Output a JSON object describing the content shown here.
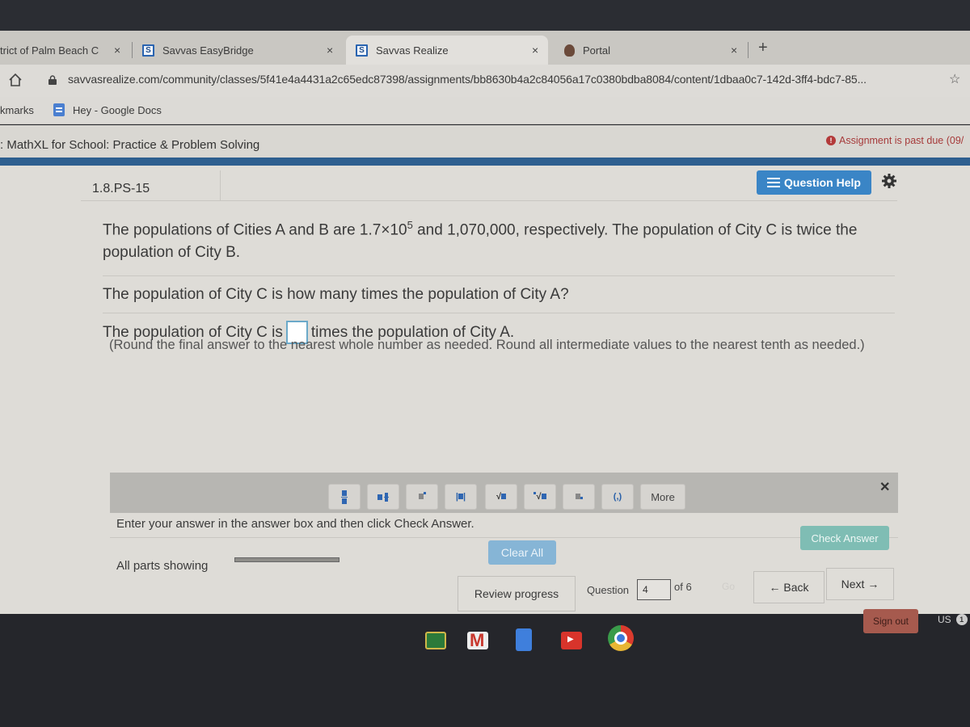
{
  "browser": {
    "tabs": [
      {
        "title": "trict of Palm Beach C",
        "favicon": "district-icon",
        "active": false
      },
      {
        "title": "Savvas EasyBridge",
        "favicon": "savvas-icon",
        "active": false
      },
      {
        "title": "Savvas Realize",
        "favicon": "savvas-icon",
        "active": true
      },
      {
        "title": "Portal",
        "favicon": "portal-icon",
        "active": false
      }
    ],
    "favicon_letter": "S",
    "close_glyph": "×",
    "new_tab_glyph": "+",
    "url": "savvasrealize.com/community/classes/5f41e4a4431a2c65edc87398/assignments/bb8630b4a2c84056a17c0380bdba8084/content/1dbaa0c7-142d-3ff4-bdc7-85...",
    "star_glyph": "☆",
    "bookmarks_label": "kmarks",
    "bookmarks": [
      {
        "label": "Hey - Google Docs",
        "icon": "google-docs-icon"
      }
    ]
  },
  "app": {
    "title": ": MathXL for School: Practice & Problem Solving",
    "due_notice": "Assignment is past due (09/",
    "due_icon": "!",
    "question_id": "1.8.PS-15",
    "question_help_label": "Question Help"
  },
  "question": {
    "intro_part1": "The populations of Cities A and B are 1.7",
    "times": "×",
    "base": "10",
    "exponent": "5",
    "intro_part2": " and 1,070,000, respectively. The population of City C is twice the population of City B.",
    "prompt": "The population of City C is how many times the population of City A?",
    "answer_prefix": "The population of City C is",
    "answer_value": "",
    "answer_suffix": "times the population of City A.",
    "rounding_note": "(Round the final answer to the nearest whole number as needed. Round all intermediate values to the nearest tenth as needed.)"
  },
  "palette": {
    "buttons": [
      {
        "name": "fraction",
        "label": ""
      },
      {
        "name": "mixed-number",
        "label": ""
      },
      {
        "name": "exponent",
        "label": ""
      },
      {
        "name": "absolute-value",
        "label": ""
      },
      {
        "name": "square-root",
        "label": "√"
      },
      {
        "name": "nth-root",
        "label": "√"
      },
      {
        "name": "subscript",
        "label": ""
      },
      {
        "name": "ordered-pair",
        "label": "(,)"
      }
    ],
    "more_label": "More",
    "close_glyph": "✕"
  },
  "footer": {
    "instructions": "Enter your answer in the answer box and then click Check Answer.",
    "parts_label": "All parts showing",
    "clear_all_label": "Clear All",
    "check_answer_label": "Check Answer",
    "review_progress_label": "Review progress",
    "question_label": "Question",
    "question_number": "4",
    "of_label": "of 6",
    "go_label": "Go",
    "back_label": "← Back",
    "next_label": "Next →"
  },
  "shelf": {
    "apps": [
      "Google Classroom",
      "Gmail",
      "Google Docs",
      "YouTube",
      "Chrome"
    ],
    "sign_out_label": "Sign out",
    "locale": "US",
    "notification_count": "1"
  }
}
